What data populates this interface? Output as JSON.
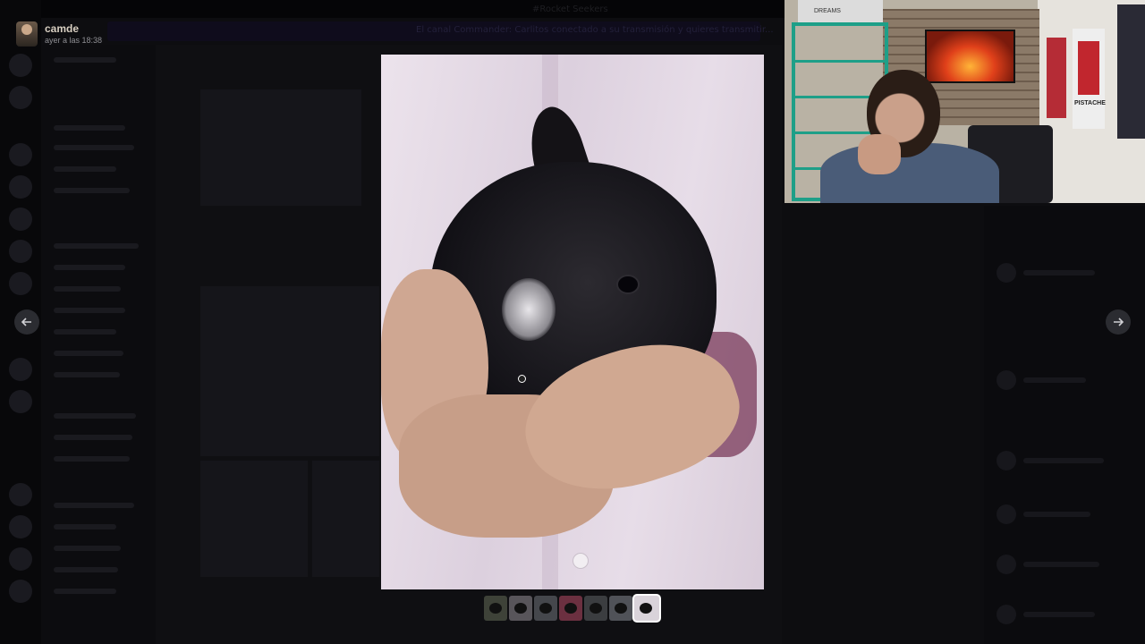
{
  "background": {
    "top_title": "#Rocket Seekers",
    "banner_text": "El canal Commander: Carlitos conectado a su transmisión y quieres transmitir..."
  },
  "viewer": {
    "author_name": "camde",
    "timestamp": "ayer a las 18:38",
    "prev_icon": "arrow-left-icon",
    "next_icon": "arrow-right-icon",
    "thumbnails": [
      {
        "color": "#3e4238"
      },
      {
        "color": "#58555a"
      },
      {
        "color": "#45474c"
      },
      {
        "color": "#6b3040"
      },
      {
        "color": "#3b3d40"
      },
      {
        "color": "#505258"
      },
      {
        "color": "#d9d3da"
      }
    ],
    "active_thumbnail": 7
  },
  "webcam": {
    "shelf_label": "DREAMS",
    "poster_label": "PISTACHE"
  },
  "colors": {
    "backdrop": "#000000",
    "nav_button": "#2b2c31",
    "author_name": "#d8cfc1",
    "timestamp": "#8e8e93"
  }
}
